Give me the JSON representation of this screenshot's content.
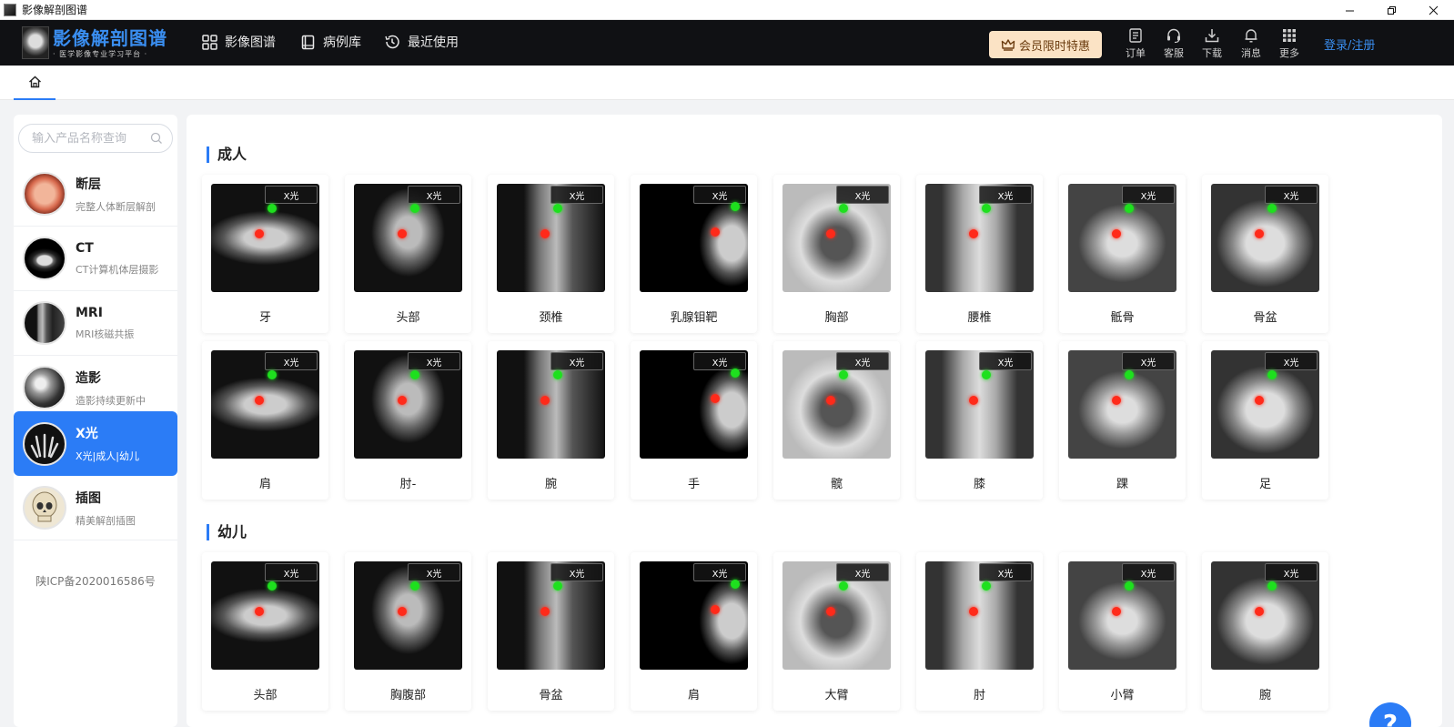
{
  "window": {
    "title": "影像解剖图谱"
  },
  "brand": {
    "name": "影像解剖图谱",
    "tagline": "· 医学影像专业学习平台 ·"
  },
  "nav": [
    {
      "label": "影像图谱",
      "icon": "grid-icon"
    },
    {
      "label": "病例库",
      "icon": "book-icon"
    },
    {
      "label": "最近使用",
      "icon": "history-icon"
    }
  ],
  "vip": {
    "label": "会员限时特惠",
    "icon": "crown-icon"
  },
  "tools": [
    {
      "label": "订单",
      "icon": "order-icon"
    },
    {
      "label": "客服",
      "icon": "headset-icon"
    },
    {
      "label": "下载",
      "icon": "download-icon"
    },
    {
      "label": "消息",
      "icon": "bell-icon"
    },
    {
      "label": "更多",
      "icon": "more-grid-icon"
    }
  ],
  "login": {
    "label": "登录/注册"
  },
  "search": {
    "placeholder": "输入产品名称查询"
  },
  "categories": [
    {
      "name": "断层",
      "desc": "完整人体断层解剖",
      "active": false
    },
    {
      "name": "CT",
      "desc": "CT计算机体层摄影",
      "active": false
    },
    {
      "name": "MRI",
      "desc": "MRI核磁共振",
      "active": false
    },
    {
      "name": "造影",
      "desc": "造影持续更新中",
      "active": false
    },
    {
      "name": "X光",
      "desc": "X光|成人|幼儿",
      "active": true
    },
    {
      "name": "插图",
      "desc": "精美解剖插图",
      "active": false
    }
  ],
  "icp": "陕ICP备2020016586号",
  "badge_text": "X光",
  "sections": [
    {
      "title": "成人",
      "items": [
        "牙",
        "头部",
        "颈椎",
        "乳腺钼靶",
        "胸部",
        "腰椎",
        "骶骨",
        "骨盆",
        "肩",
        "肘-",
        "腕",
        "手",
        "髋",
        "膝",
        "踝",
        "足"
      ]
    },
    {
      "title": "幼儿",
      "items": [
        "头部",
        "胸腹部",
        "骨盆",
        "肩",
        "大臂",
        "肘",
        "小臂",
        "腕"
      ]
    }
  ],
  "help": {
    "label": "?"
  }
}
